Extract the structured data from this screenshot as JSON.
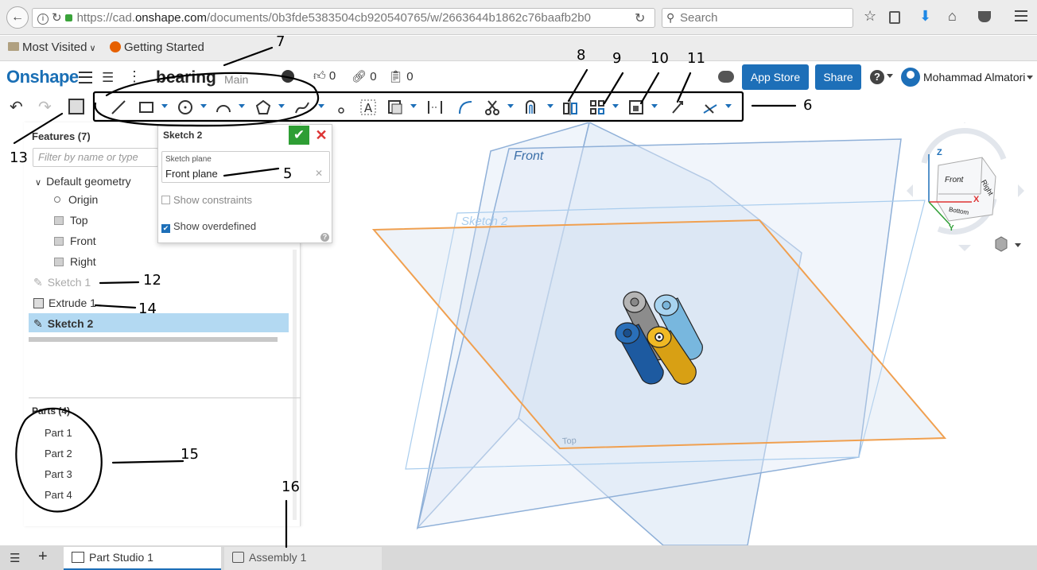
{
  "browser": {
    "url_prefix": "https://cad.",
    "url_domain": "onshape.com",
    "url_rest": "/documents/0b3fde5383504cb920540765/w/2663644b1862c76baafb2b0",
    "search_placeholder": "Search",
    "bookmarks": [
      "Most Visited",
      "Getting Started"
    ]
  },
  "header": {
    "logo": "Onshape",
    "doc_name": "bearing",
    "branch": "Main",
    "likes": "0",
    "links": "0",
    "copies": "0",
    "app_store": "App Store",
    "share": "Share",
    "user": "Mohammad Almatori"
  },
  "features": {
    "title": "Features (7)",
    "filter_placeholder": "Filter by name or type",
    "default_geometry": "Default geometry",
    "origin": "Origin",
    "top": "Top",
    "front": "Front",
    "right": "Right",
    "sketch1": "Sketch 1",
    "extrude1": "Extrude 1",
    "sketch2": "Sketch 2"
  },
  "parts": {
    "title": "Parts (4)",
    "items": [
      "Part 1",
      "Part 2",
      "Part 3",
      "Part 4"
    ]
  },
  "dialog": {
    "title": "Sketch 2",
    "plane_label": "Sketch plane",
    "plane_value": "Front plane",
    "show_constraints": "Show constraints",
    "show_overdefined": "Show overdefined"
  },
  "viewport": {
    "front_label": "Front",
    "sketch2_label": "Sketch 2",
    "top_label": "Top",
    "cube_front": "Front",
    "cube_right": "Right",
    "cube_bottom": "Bottom",
    "axis_z": "Z",
    "axis_x": "X",
    "axis_y": "Y"
  },
  "tabs": {
    "part_studio": "Part Studio 1",
    "assembly": "Assembly 1"
  },
  "annotations": {
    "n5": "5",
    "n6": "6",
    "n7": "7",
    "n8": "8",
    "n9": "9",
    "n10": "10",
    "n11": "11",
    "n12": "12",
    "n13": "13",
    "n14": "14",
    "n15": "15",
    "n16": "16"
  },
  "colors": {
    "accent": "#1d6fb8",
    "selected_row": "#b3d9f2",
    "sketch_plane": "#f0a050",
    "confirm": "#2e9e34",
    "cancel": "#d33"
  }
}
